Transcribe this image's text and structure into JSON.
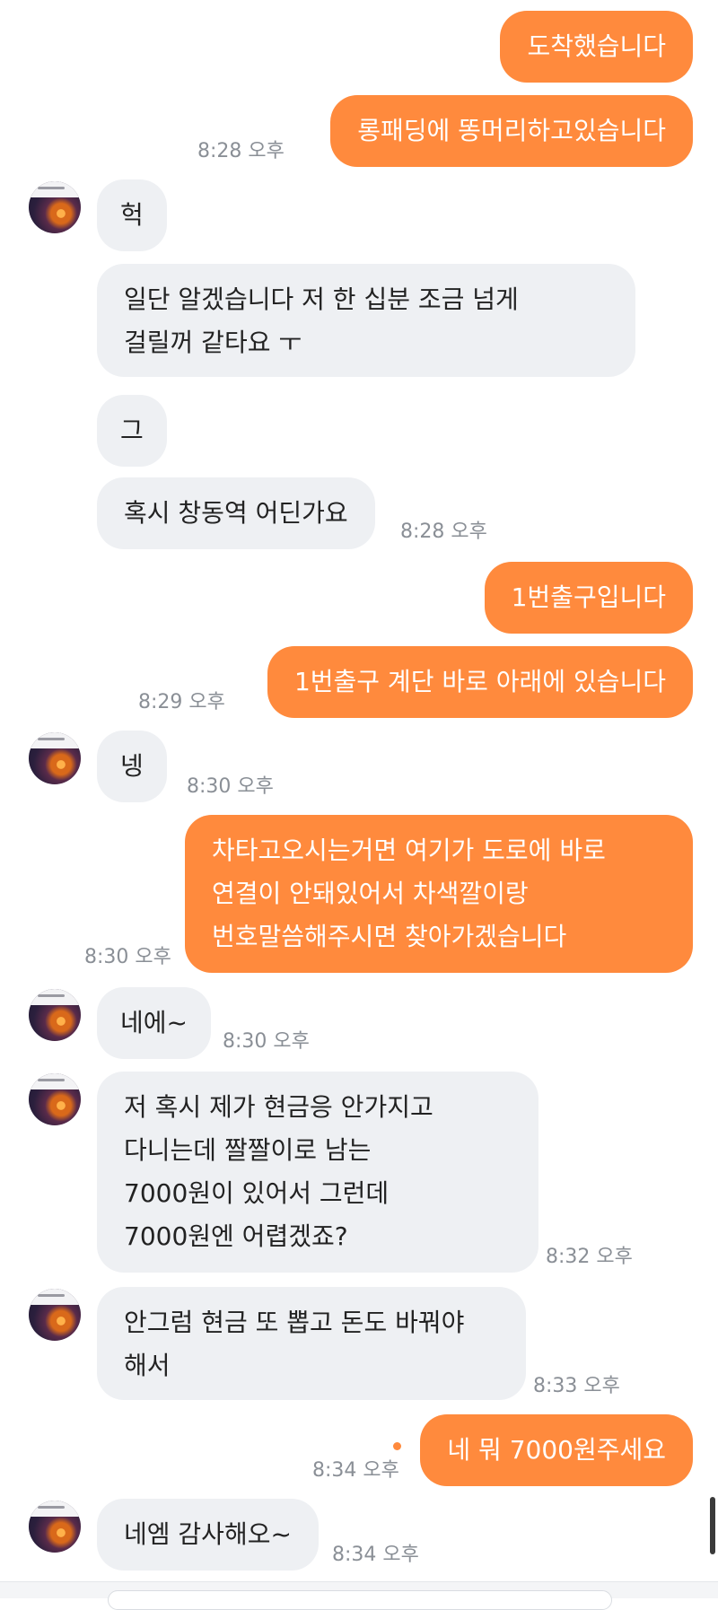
{
  "messages": [
    {
      "text": "도착했습니다"
    },
    {
      "text": "롱패딩에 똥머리하고있습니다",
      "time": "8:28 오후"
    },
    {
      "text": "헉"
    },
    {
      "line1": "일단 알겠습니다 저 한 십분 조금 넘게",
      "line2": "걸릴꺼 같타요 ㅜ"
    },
    {
      "text": "그"
    },
    {
      "text": "혹시 창동역 어딘가요",
      "time": "8:28 오후"
    },
    {
      "text": "1번출구입니다"
    },
    {
      "text": "1번출구 계단 바로 아래에 있습니다",
      "time": "8:29 오후"
    },
    {
      "text": "넹",
      "time": "8:30 오후"
    },
    {
      "line1": "차타고오시는거면 여기가 도로에 바로",
      "line2": "연결이 안돼있어서 차색깔이랑",
      "line3": "번호말씀해주시면 찾아가겠습니다",
      "time": "8:30 오후"
    },
    {
      "text": "네에~",
      "time": "8:30 오후"
    },
    {
      "line1": "저 혹시 제가 현금응 안가지고",
      "line2": "다니는데 짤짤이로 남는",
      "line3": "7000원이 있어서 그런데",
      "line4": "7000원엔 어렵겠죠?",
      "time": "8:32 오후"
    },
    {
      "line1": "안그럼 현금 또 뽑고 돈도 바꿔야",
      "line2": "해서",
      "time": "8:33 오후"
    },
    {
      "text": "네 뭐 7000원주세요",
      "time": "8:34 오후"
    },
    {
      "text": "네엠 감사해오~",
      "time": "8:34 오후"
    }
  ],
  "colors": {
    "sent_bubble": "#ff8a3d",
    "received_bubble": "#eef0f3",
    "timestamp": "#8a8f96",
    "unread_dot": "#ff8a3d"
  }
}
